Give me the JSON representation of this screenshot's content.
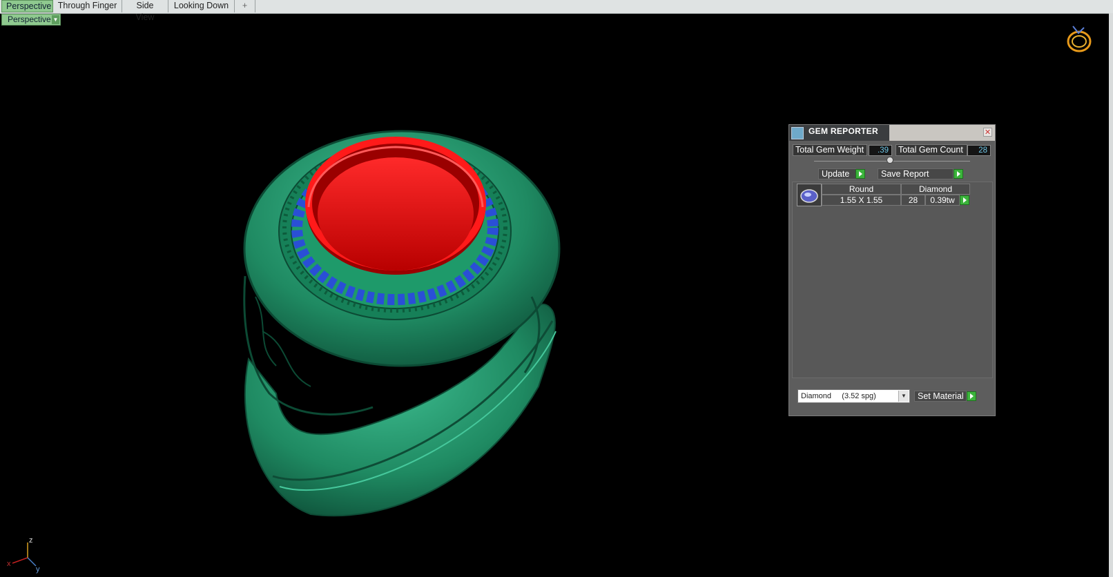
{
  "tabs": [
    {
      "label": "Perspective",
      "active": true
    },
    {
      "label": "Through Finger",
      "active": false
    },
    {
      "label": "Side View",
      "active": false
    },
    {
      "label": "Looking Down",
      "active": false
    },
    {
      "label": "+",
      "active": false
    }
  ],
  "viewport": {
    "label": "Perspective"
  },
  "axes": {
    "z": "z",
    "x": "x",
    "y": "y"
  },
  "gem_reporter": {
    "title": "GEM REPORTER",
    "total_weight_label": "Total Gem Weight",
    "total_weight_value": ".39",
    "total_count_label": "Total Gem Count",
    "total_count_value": "28",
    "update_label": "Update",
    "save_report_label": "Save Report",
    "rows": [
      {
        "shape": "Round",
        "material": "Diamond",
        "size": "1.55 X 1.55",
        "count": "28",
        "weight": "0.39tw"
      }
    ],
    "material_select": "Diamond     (3.52 spg)",
    "set_material_label": "Set Material"
  },
  "colors": {
    "viewport_bg": "#000000",
    "ring_metal": "#1f8a62",
    "center_stone": "#ff0000",
    "side_stones": "#2a4fd6",
    "tab_active": "#8fc98f"
  }
}
